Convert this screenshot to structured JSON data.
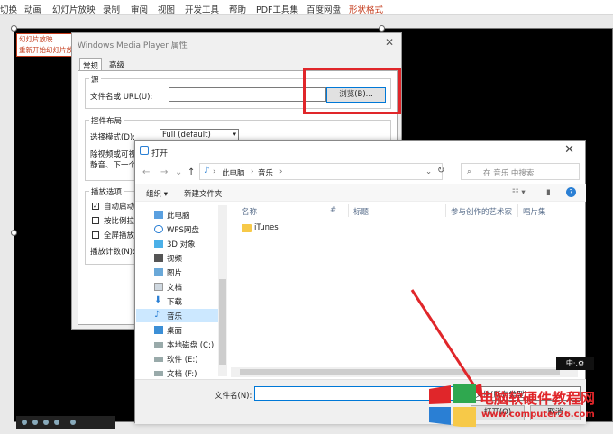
{
  "ribbon": {
    "tabs": [
      "切换",
      "动画",
      "幻灯片放映",
      "录制",
      "审阅",
      "视图",
      "开发工具",
      "帮助",
      "PDF工具集",
      "百度网盘"
    ],
    "active_tab": "形状格式"
  },
  "slide": {
    "anim_lines": [
      "幻灯片放映",
      "重新开始幻灯片放"
    ]
  },
  "wmp_dialog": {
    "title": "Windows Media Player 属性",
    "close": "✕",
    "tabs": [
      "常规",
      "高级"
    ],
    "source_group": "源",
    "file_label": "文件名或 URL(U):",
    "file_value": "",
    "browse_button": "浏览(B)...",
    "layout_group": "控件布局",
    "mode_label": "选择模式(D):",
    "mode_value": "Full (default)",
    "desc_line1": "除视频或可视",
    "desc_line2": "静音、下一个",
    "playback_group": "播放选项",
    "opt_autostart": "自动启动(",
    "opt_stretch": "按比例拉伸",
    "opt_fullscreen": "全屏播放(",
    "playcount_label": "播放计数(N):"
  },
  "open_dialog": {
    "title": "打开",
    "close": "✕",
    "nav": {
      "back": "←",
      "forward": "→",
      "dropdown": "⌄",
      "up": "↑"
    },
    "breadcrumb": [
      "此电脑",
      "音乐"
    ],
    "breadcrumb_sep": "›",
    "refresh": "↻",
    "search_placeholder": "在 音乐 中搜索",
    "organize": "组织 ▾",
    "new_folder": "新建文件夹",
    "help": "?",
    "tree": [
      {
        "label": "此电脑",
        "icon": "computer-icon"
      },
      {
        "label": "WPS网盘",
        "icon": "cloud-icon"
      },
      {
        "label": "3D 对象",
        "icon": "cube-icon"
      },
      {
        "label": "视频",
        "icon": "video-icon"
      },
      {
        "label": "图片",
        "icon": "picture-icon"
      },
      {
        "label": "文档",
        "icon": "document-icon"
      },
      {
        "label": "下载",
        "icon": "download-icon"
      },
      {
        "label": "音乐",
        "icon": "music-icon"
      },
      {
        "label": "桌面",
        "icon": "desktop-icon"
      },
      {
        "label": "本地磁盘 (C:)",
        "icon": "drive-icon"
      },
      {
        "label": "软件 (E:)",
        "icon": "drive-icon"
      },
      {
        "label": "文档 (F:)",
        "icon": "drive-icon"
      }
    ],
    "columns": [
      "名称",
      "#",
      "标题",
      "参与创作的艺术家",
      "唱片集"
    ],
    "files": [
      {
        "name": "iTunes",
        "icon": "folder-icon"
      }
    ],
    "filename_label": "文件名(N):",
    "filename_value": "",
    "filetype_value": "文件(所有类型)",
    "open_button": "打开(O)",
    "cancel_button": "取消"
  },
  "ime": {
    "label": "中·,⚙"
  },
  "watermark": {
    "title": "电脑软硬件教程网",
    "url": "www.computer26.com"
  },
  "colors": {
    "accent_red": "#e0262a",
    "selection": "#cce8ff",
    "folder": "#f7c948"
  }
}
